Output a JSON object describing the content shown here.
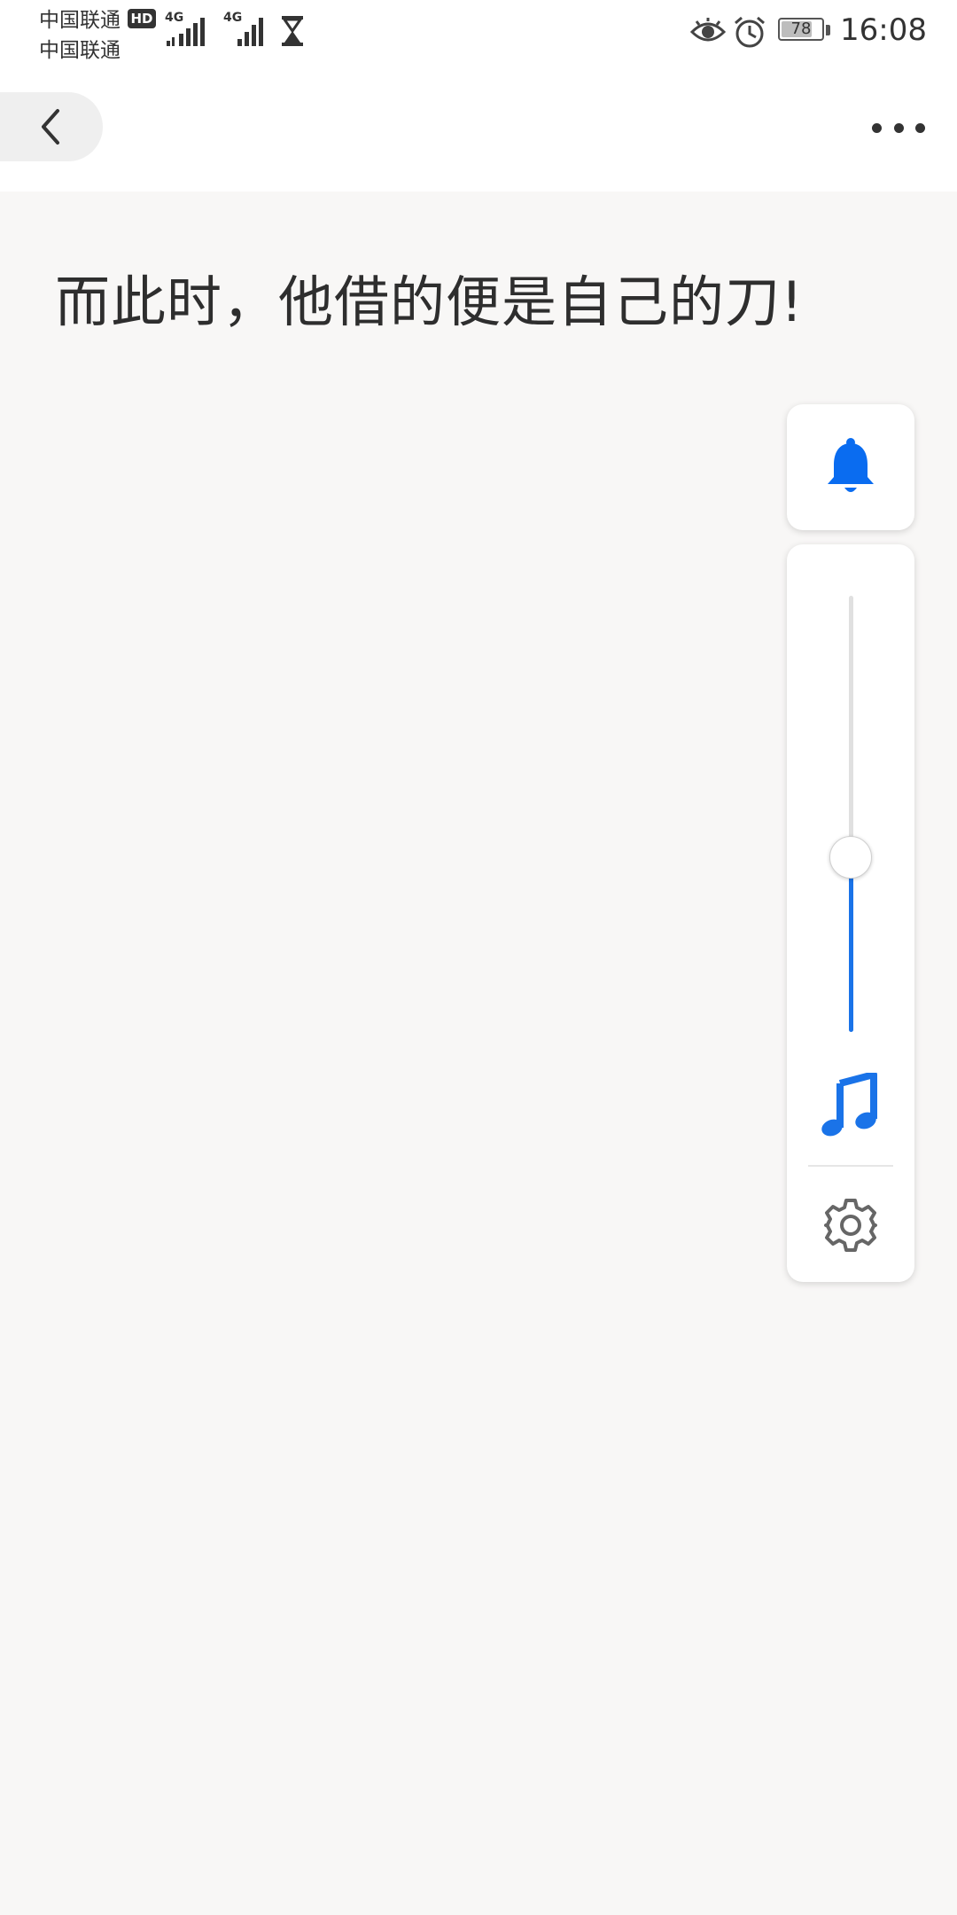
{
  "status_bar": {
    "carrier_1": "中国联通",
    "carrier_2": "中国联通",
    "hd_badge": "HD",
    "signal_1_type": "4G",
    "signal_2_type": "4G",
    "battery_level": "78",
    "battery_percent": 78,
    "time": "16:08"
  },
  "nav": {
    "back_icon": "chevron-left-icon",
    "more_icon": "more-horizontal-icon"
  },
  "content": {
    "text": "而此时，他借的便是自己的刀!"
  },
  "volume_panel": {
    "ring_mode_icon": "bell-icon",
    "media_volume_fraction": 0.4,
    "media_icon": "music-note-icon",
    "settings_icon": "gear-icon",
    "accent_color": "#1a73e8"
  }
}
